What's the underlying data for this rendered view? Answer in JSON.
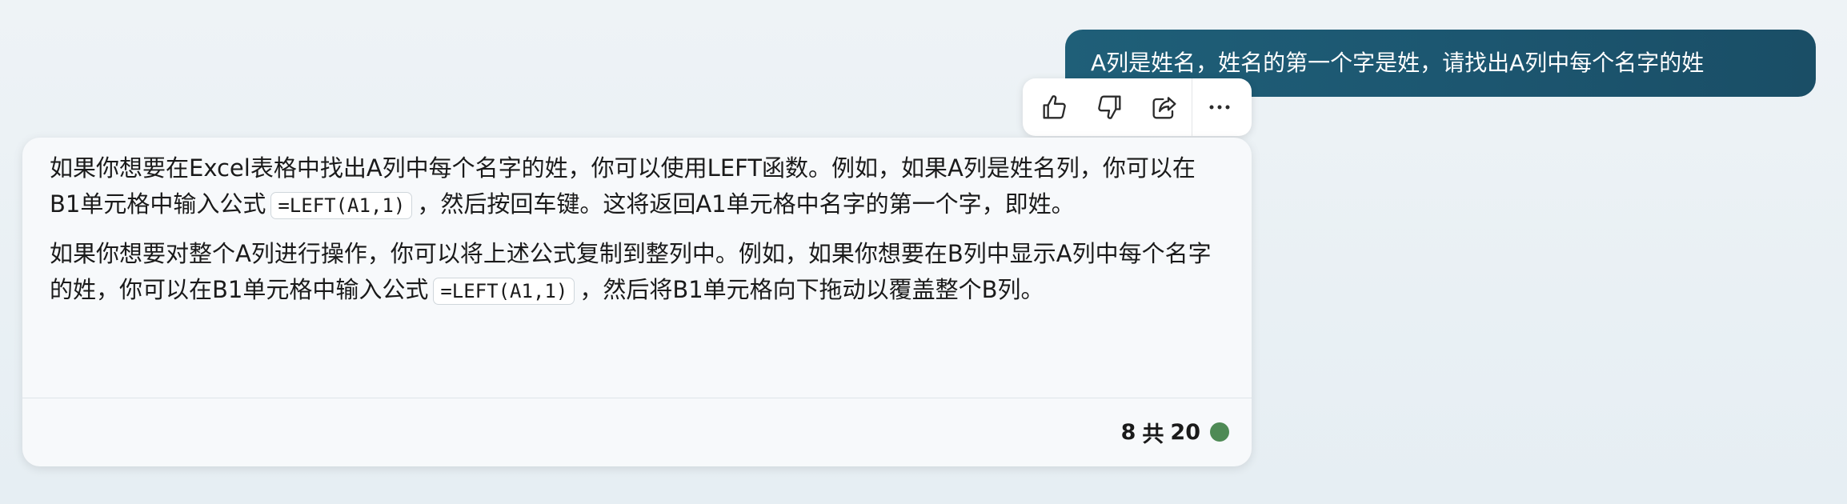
{
  "user_message": {
    "text": "A列是姓名，姓名的第一个字是姓，请找出A列中每个名字的姓"
  },
  "toolbar": {
    "icons": [
      "thumbs-up-icon",
      "thumbs-down-icon",
      "share-icon",
      "more-icon"
    ]
  },
  "assistant_message": {
    "paragraph1": {
      "part1": "如果你想要在Excel表格中找出A列中每个名字的姓，你可以使用LEFT函数。例如，如果A列是姓名列，你可以在B1单元格中输入公式",
      "code": "=LEFT(A1,1)",
      "part2": "，然后按回车键。这将返回A1单元格中名字的第一个字，即姓。"
    },
    "paragraph2": {
      "part1": "如果你想要对整个A列进行操作，你可以将上述公式复制到整列中。例如，如果你想要在B列中显示A列中每个名字的姓，你可以在B1单元格中输入公式",
      "code": "=LEFT(A1,1)",
      "part2": "，然后将B1单元格向下拖动以覆盖整个B列。"
    }
  },
  "footer": {
    "counter_current": "8",
    "counter_separator": "共",
    "counter_total": "20",
    "status_color": "#4e8a55"
  },
  "colors": {
    "user_bubble": "#1c5670",
    "status_dot": "#4e8a55"
  }
}
